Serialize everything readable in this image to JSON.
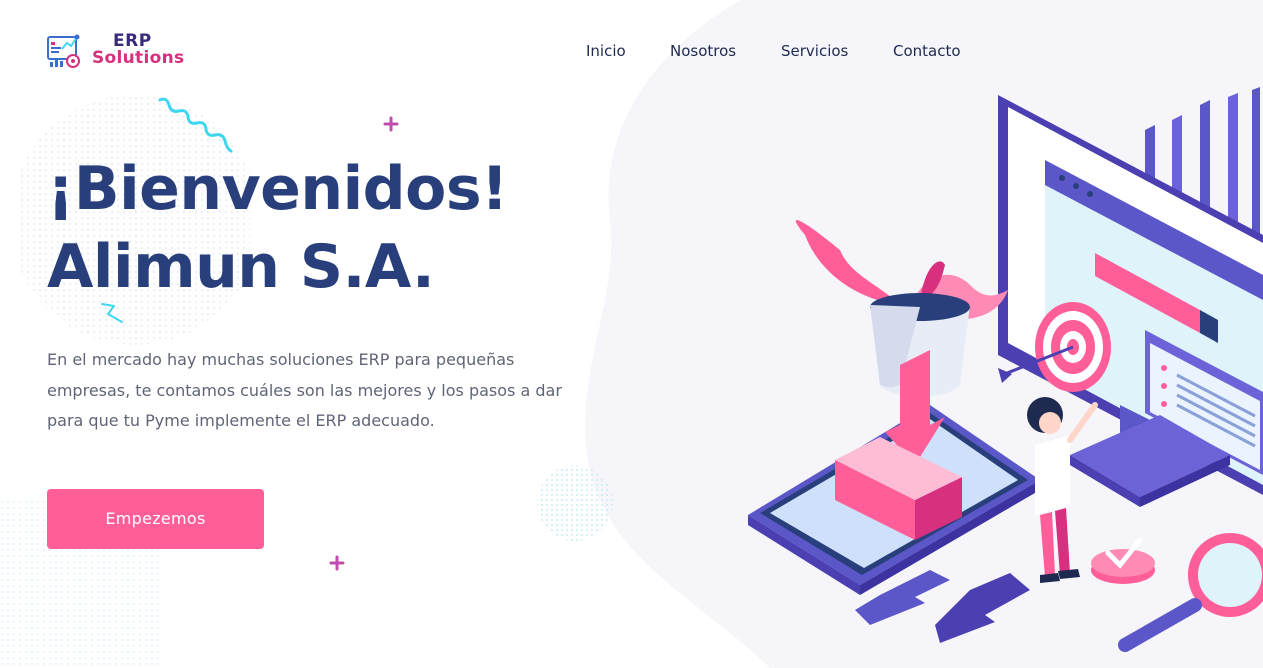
{
  "header": {
    "logo": {
      "line1": "ERP",
      "line2": "Solutions"
    },
    "nav": [
      {
        "label": "Inicio"
      },
      {
        "label": "Nosotros"
      },
      {
        "label": "Servicios"
      },
      {
        "label": "Contacto"
      }
    ]
  },
  "hero": {
    "title_line1": "¡Bienvenidos!",
    "title_line2": "Alimun S.A.",
    "description": "En el mercado hay muchas soluciones ERP para pequeñas empresas, te contamos cuáles son las mejores y los pasos a dar para que tu Pyme implemente el ERP adecuado.",
    "cta_label": "Empezemos"
  },
  "colors": {
    "title": "#283f7c",
    "nav_text": "#1e2a4f",
    "cta_bg": "#ff5e99",
    "accent_purple": "#6c63d9",
    "accent_pink": "#ff5e99",
    "deco_cyan": "#3fd6f0",
    "deco_plus": "#c04cb0"
  }
}
